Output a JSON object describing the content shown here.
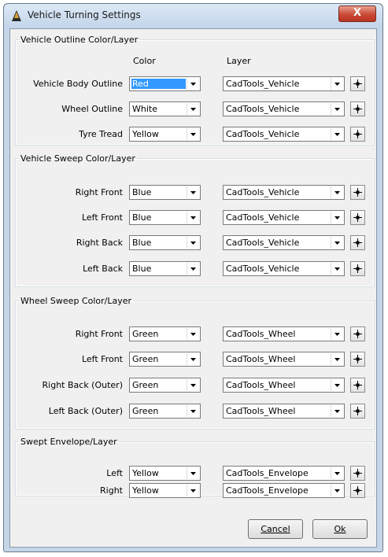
{
  "window": {
    "title": "Vehicle Turning Settings",
    "close_label": "X"
  },
  "column_headers": {
    "color": "Color",
    "layer": "Layer"
  },
  "groups": [
    {
      "title": "Vehicle Outline Color/Layer",
      "rows": [
        {
          "label": "Vehicle Body Outline",
          "color": "Red",
          "layer": "CadTools_Vehicle",
          "selected": true
        },
        {
          "label": "Wheel Outline",
          "color": "White",
          "layer": "CadTools_Vehicle"
        },
        {
          "label": "Tyre Tread",
          "color": "Yellow",
          "layer": "CadTools_Vehicle"
        }
      ]
    },
    {
      "title": "Vehicle Sweep Color/Layer",
      "rows": [
        {
          "label": "Right Front",
          "color": "Blue",
          "layer": "CadTools_Vehicle"
        },
        {
          "label": "Left Front",
          "color": "Blue",
          "layer": "CadTools_Vehicle"
        },
        {
          "label": "Right Back",
          "color": "Blue",
          "layer": "CadTools_Vehicle"
        },
        {
          "label": "Left Back",
          "color": "Blue",
          "layer": "CadTools_Vehicle"
        }
      ]
    },
    {
      "title": "Wheel Sweep Color/Layer",
      "rows": [
        {
          "label": "Right Front",
          "color": "Green",
          "layer": "CadTools_Wheel"
        },
        {
          "label": "Left Front",
          "color": "Green",
          "layer": "CadTools_Wheel"
        },
        {
          "label": "Right Back (Outer)",
          "color": "Green",
          "layer": "CadTools_Wheel"
        },
        {
          "label": "Left Back (Outer)",
          "color": "Green",
          "layer": "CadTools_Wheel"
        }
      ]
    },
    {
      "title": "Swept Envelope/Layer",
      "rows": [
        {
          "label": "Left",
          "color": "Yellow",
          "layer": "CadTools_Envelope"
        },
        {
          "label": "Right",
          "color": "Yellow",
          "layer": "CadTools_Envelope"
        }
      ]
    }
  ],
  "buttons": {
    "cancel": "Cancel",
    "ok": "Ok"
  }
}
